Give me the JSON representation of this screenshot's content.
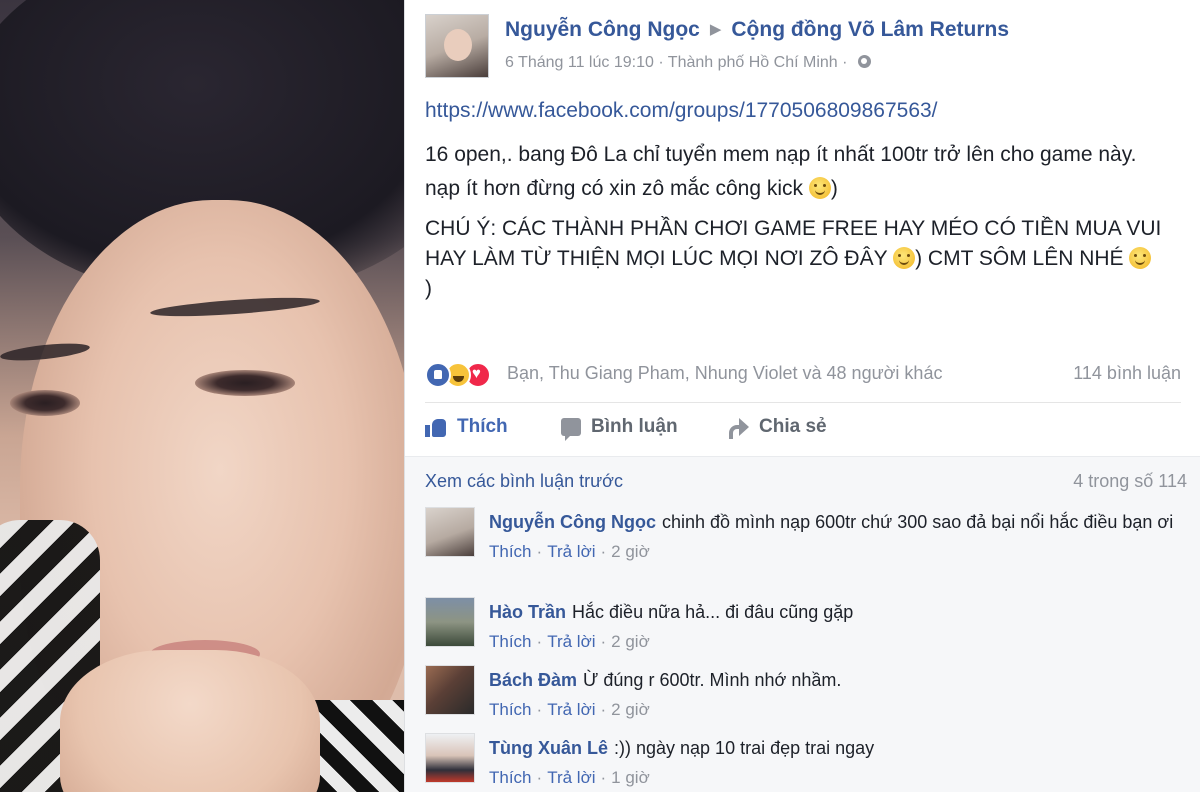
{
  "post": {
    "author": "Nguyễn Công Ngọc",
    "group": "Cộng đồng Võ Lâm Returns",
    "timestamp": "6 Tháng 11 lúc 19:10",
    "location": "Thành phố Hồ Chí Minh",
    "separator": "·",
    "link": "https://www.facebook.com/groups/1770506809867563/",
    "text_line1": "16 open,. bang Đô La chỉ tuyển mem nạp ít nhất 100tr trở lên cho game này.",
    "text_line2": "nạp ít hơn đừng có xin zô mắc công kick",
    "text_line2_end": ")",
    "text_line3a": "CHÚ Ý: CÁC THÀNH PHẦN CHƠI GAME FREE HAY MÉO CÓ TIỀN MUA VUI HAY LÀM TỪ THIỆN MỌI LÚC MỌI NƠI ZÔ ĐÂY",
    "text_line3b": ") CMT SÔM LÊN NHÉ",
    "text_line3c": ")"
  },
  "reactions": {
    "icons": [
      "like-icon",
      "haha-icon",
      "love-icon"
    ],
    "people": "Bạn, Thu Giang Pham, Nhung Violet và 48 người khác",
    "comments_count": "114 bình luận"
  },
  "actions": {
    "like": "Thích",
    "comment": "Bình luận",
    "share": "Chia sẻ"
  },
  "comments": {
    "view_previous": "Xem các bình luận trước",
    "shown_of_total": "4 trong số 114",
    "items": [
      {
        "name": "Nguyễn Công Ngọc",
        "text": "chinh đồ mình nạp 600tr chứ 300 sao đả bại nổi hắc điều bạn ơi",
        "like": "Thích",
        "reply": "Trả lời",
        "time": "2 giờ"
      },
      {
        "name": "Hào Trần",
        "text": "Hắc điều nữa hả... đi đâu cũng gặp",
        "like": "Thích",
        "reply": "Trả lời",
        "time": "2 giờ"
      },
      {
        "name": "Bách Đàm",
        "text": "Ừ đúng r 600tr. Mình nhớ nhầm.",
        "like": "Thích",
        "reply": "Trả lời",
        "time": "2 giờ"
      },
      {
        "name": "Tùng Xuân Lê",
        "text": ":)) ngày nạp 10 trai đẹp trai ngay",
        "like": "Thích",
        "reply": "Trả lời",
        "time": "1 giờ"
      }
    ]
  },
  "colors": {
    "link_blue": "#365899",
    "action_blue": "#4267b2",
    "meta_gray": "#90949c",
    "comments_bg": "#f6f7f9"
  }
}
